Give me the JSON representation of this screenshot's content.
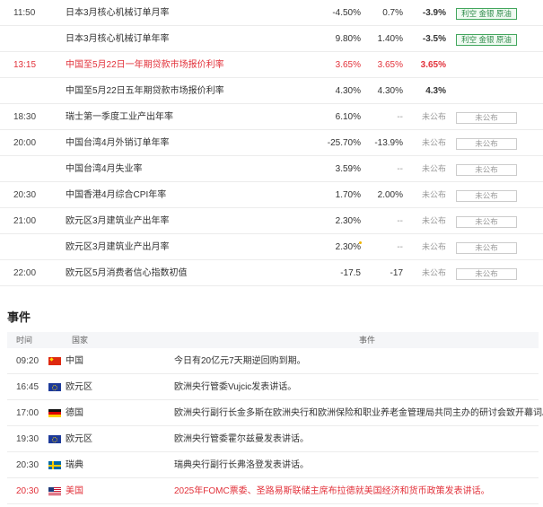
{
  "econ_rows": [
    {
      "time": "11:50",
      "flag": "jp",
      "name": "日本3月核心机械订单月率",
      "prev": "-4.50%",
      "forecast": "0.7%",
      "actual": "-3.9%",
      "badge": "利空 金银 原油",
      "badge_style": "green",
      "highlight": false
    },
    {
      "time": "",
      "flag": "",
      "name": "日本3月核心机械订单年率",
      "prev": "9.80%",
      "forecast": "1.40%",
      "actual": "-3.5%",
      "badge": "利空 金银 原油",
      "badge_style": "green",
      "highlight": false
    },
    {
      "time": "13:15",
      "flag": "cn",
      "name": "中国至5月22日一年期贷款市场报价利率",
      "prev": "3.65%",
      "forecast": "3.65%",
      "actual": "3.65%",
      "badge": "",
      "badge_style": "",
      "highlight": true
    },
    {
      "time": "",
      "flag": "",
      "name": "中国至5月22日五年期贷款市场报价利率",
      "prev": "4.30%",
      "forecast": "4.30%",
      "actual": "4.3%",
      "badge": "",
      "badge_style": "",
      "highlight": false
    },
    {
      "time": "18:30",
      "flag": "ch",
      "name": "瑞士第一季度工业产出年率",
      "prev": "6.10%",
      "forecast": "--",
      "actual": "未公布",
      "badge": "未公布",
      "badge_style": "gray",
      "highlight": false
    },
    {
      "time": "20:00",
      "flag": "tw",
      "name": "中国台湾4月外销订单年率",
      "prev": "-25.70%",
      "forecast": "-13.9%",
      "actual": "未公布",
      "badge": "未公布",
      "badge_style": "gray",
      "highlight": false
    },
    {
      "time": "",
      "flag": "",
      "name": "中国台湾4月失业率",
      "prev": "3.59%",
      "forecast": "--",
      "actual": "未公布",
      "badge": "未公布",
      "badge_style": "gray",
      "highlight": false
    },
    {
      "time": "20:30",
      "flag": "hk",
      "name": "中国香港4月综合CPI年率",
      "prev": "1.70%",
      "forecast": "2.00%",
      "actual": "未公布",
      "badge": "未公布",
      "badge_style": "gray",
      "highlight": false
    },
    {
      "time": "21:00",
      "flag": "eu",
      "name": "欧元区3月建筑业产出年率",
      "prev": "2.30%",
      "forecast": "--",
      "actual": "未公布",
      "badge": "未公布",
      "badge_style": "gray",
      "highlight": false
    },
    {
      "time": "",
      "flag": "",
      "name": "欧元区3月建筑业产出月率",
      "prev": "2.30%",
      "forecast": "--",
      "actual": "未公布",
      "badge": "未公布",
      "badge_style": "gray",
      "highlight": false,
      "star": true
    },
    {
      "time": "22:00",
      "flag": "eu",
      "name": "欧元区5月消费者信心指数初值",
      "prev": "-17.5",
      "forecast": "-17",
      "actual": "未公布",
      "badge": "未公布",
      "badge_style": "gray",
      "highlight": false
    }
  ],
  "events": {
    "title": "事件",
    "headers": {
      "time": "时间",
      "country": "国家",
      "event": "事件"
    },
    "rows": [
      {
        "time": "09:20",
        "flag": "cn",
        "country": "中国",
        "text": "今日有20亿元7天期逆回购到期。",
        "highlight": false
      },
      {
        "time": "16:45",
        "flag": "eu",
        "country": "欧元区",
        "text": "欧洲央行管委Vujcic发表讲话。",
        "highlight": false
      },
      {
        "time": "17:00",
        "flag": "de",
        "country": "德国",
        "text": "欧洲央行副行长金多斯在欧洲央行和欧洲保险和职业养老金管理局共同主办的研讨会致开幕词。",
        "highlight": false
      },
      {
        "time": "19:30",
        "flag": "eu",
        "country": "欧元区",
        "text": "欧洲央行管委霍尔兹曼发表讲话。",
        "highlight": false
      },
      {
        "time": "20:30",
        "flag": "se",
        "country": "瑞典",
        "text": "瑞典央行副行长弗洛登发表讲话。",
        "highlight": false
      },
      {
        "time": "20:30",
        "flag": "us",
        "country": "美国",
        "text": "2025年FOMC票委、圣路易斯联储主席布拉德就美国经济和货币政策发表讲话。",
        "highlight": true
      }
    ]
  }
}
